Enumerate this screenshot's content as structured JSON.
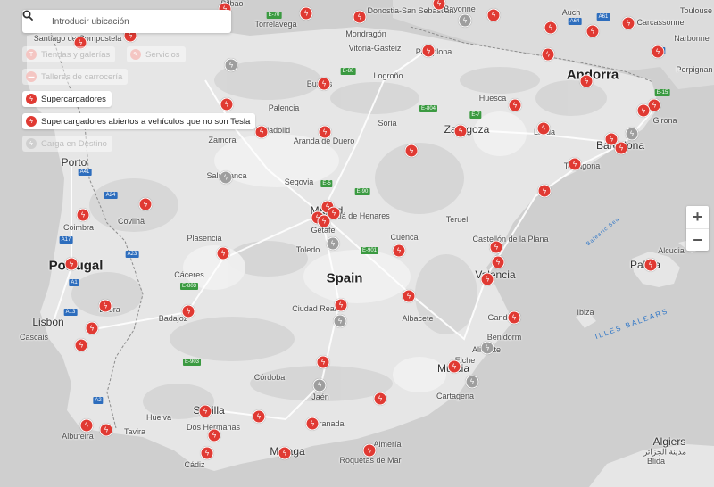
{
  "search": {
    "placeholder": "Introducir ubicación"
  },
  "filters": [
    {
      "label": "Tiendas y galerías",
      "state": "off",
      "icon": "store-icon"
    },
    {
      "label": "Servicios",
      "state": "off",
      "icon": "wrench-icon"
    },
    {
      "label": "Talleres de carrocería",
      "state": "off",
      "icon": "bodyshop-icon"
    },
    {
      "label": "Supercargadores",
      "state": "on",
      "icon": "supercharger-icon"
    },
    {
      "label": "Supercargadores abiertos a vehículos que no son Tesla",
      "state": "on",
      "icon": "open-supercharger-icon"
    },
    {
      "label": "Carga en Destino",
      "state": "off",
      "icon": "destination-charging-icon"
    }
  ],
  "zoom": {
    "in": "+",
    "out": "−"
  },
  "places": [
    "Spain",
    "Portugal",
    "Andorra",
    "Madrid",
    "Barcelona",
    "Zaragoza",
    "Valencia",
    "Sevilla",
    "Málaga",
    "Lisbon",
    "Porto",
    "Coimbra",
    "Algiers",
    "Palma",
    "Valladolid",
    "Burgos",
    "Bilbao",
    "Donostia-San Sebastián",
    "Bayonne",
    "Toulouse",
    "Narbonne",
    "Perpignan",
    "Girona",
    "Tarragona",
    "Lleida",
    "Huesca",
    "Pamplona",
    "Logroño",
    "Vitoria-Gasteiz",
    "Soria",
    "Teruel",
    "Castellón de la Plana",
    "Cuenca",
    "Toledo",
    "Getafe",
    "Alcalá de Henares",
    "Aranda de Duero",
    "Segovia",
    "Salamanca",
    "Zamora",
    "Palencia",
    "Plasencia",
    "Cáceres",
    "Badajoz",
    "Ciudad Real",
    "Albacete",
    "Murcia",
    "Cartagena",
    "Alicante",
    "Elche",
    "Benidorm",
    "Gandia",
    "Granada",
    "Jaén",
    "Córdoba",
    "Huelva",
    "Dos Hermanas",
    "Cádiz",
    "Almería",
    "Roquetas de Mar",
    "Évora",
    "Cascais",
    "Albufeira",
    "Tavira",
    "Covilhã",
    "Torrelavega",
    "Santiago de Compostela",
    "Alcudia",
    "Ibiza",
    "Blida",
    "مدينة الجزائر",
    "Mondragón",
    "Auch",
    "Carcassonne"
  ],
  "seas": [
    "ILLES BALEARS",
    "Balearic Sea"
  ],
  "roads": [
    "E-70",
    "E-80",
    "E-804",
    "E-7",
    "E-15",
    "E-5",
    "E-90",
    "E-901",
    "E-903",
    "E-803",
    "A1",
    "A17",
    "A23",
    "A24",
    "A41",
    "A2",
    "A13",
    "A64",
    "A61",
    "A9"
  ],
  "colors": {
    "supercharger": "#e03a33",
    "other": "#9e9e9e",
    "sea": "#cfcfcf",
    "land": "#e6e6e6"
  }
}
